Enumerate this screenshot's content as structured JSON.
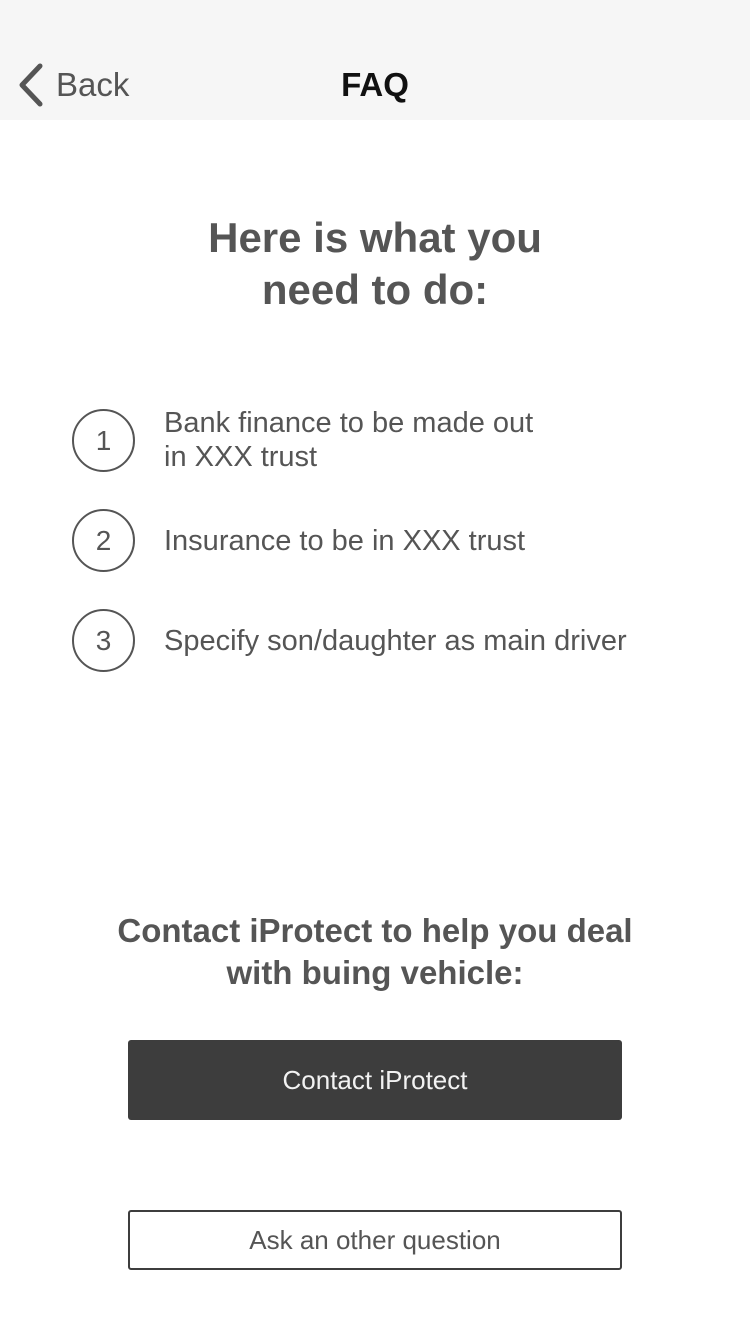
{
  "navbar": {
    "back_label": "Back",
    "title": "FAQ",
    "back_icon": "chevron-left-icon"
  },
  "main": {
    "heading_line1": "Here is what you",
    "heading_line2": "need to do:",
    "steps": [
      {
        "number": "1",
        "text": "Bank finance to be made out\nin XXX trust"
      },
      {
        "number": "2",
        "text": "Insurance to be in XXX trust"
      },
      {
        "number": "3",
        "text": "Specify son/daughter as main driver"
      }
    ],
    "contact_prompt_line1": "Contact iProtect to help you deal",
    "contact_prompt_line2": "with buing vehicle:",
    "contact_button_label": "Contact iProtect",
    "ask_button_label": "Ask an other question"
  },
  "colors": {
    "navbar_bg": "#f6f6f6",
    "text": "#555555",
    "title": "#111111",
    "primary_button_bg": "#3d3d3d"
  }
}
